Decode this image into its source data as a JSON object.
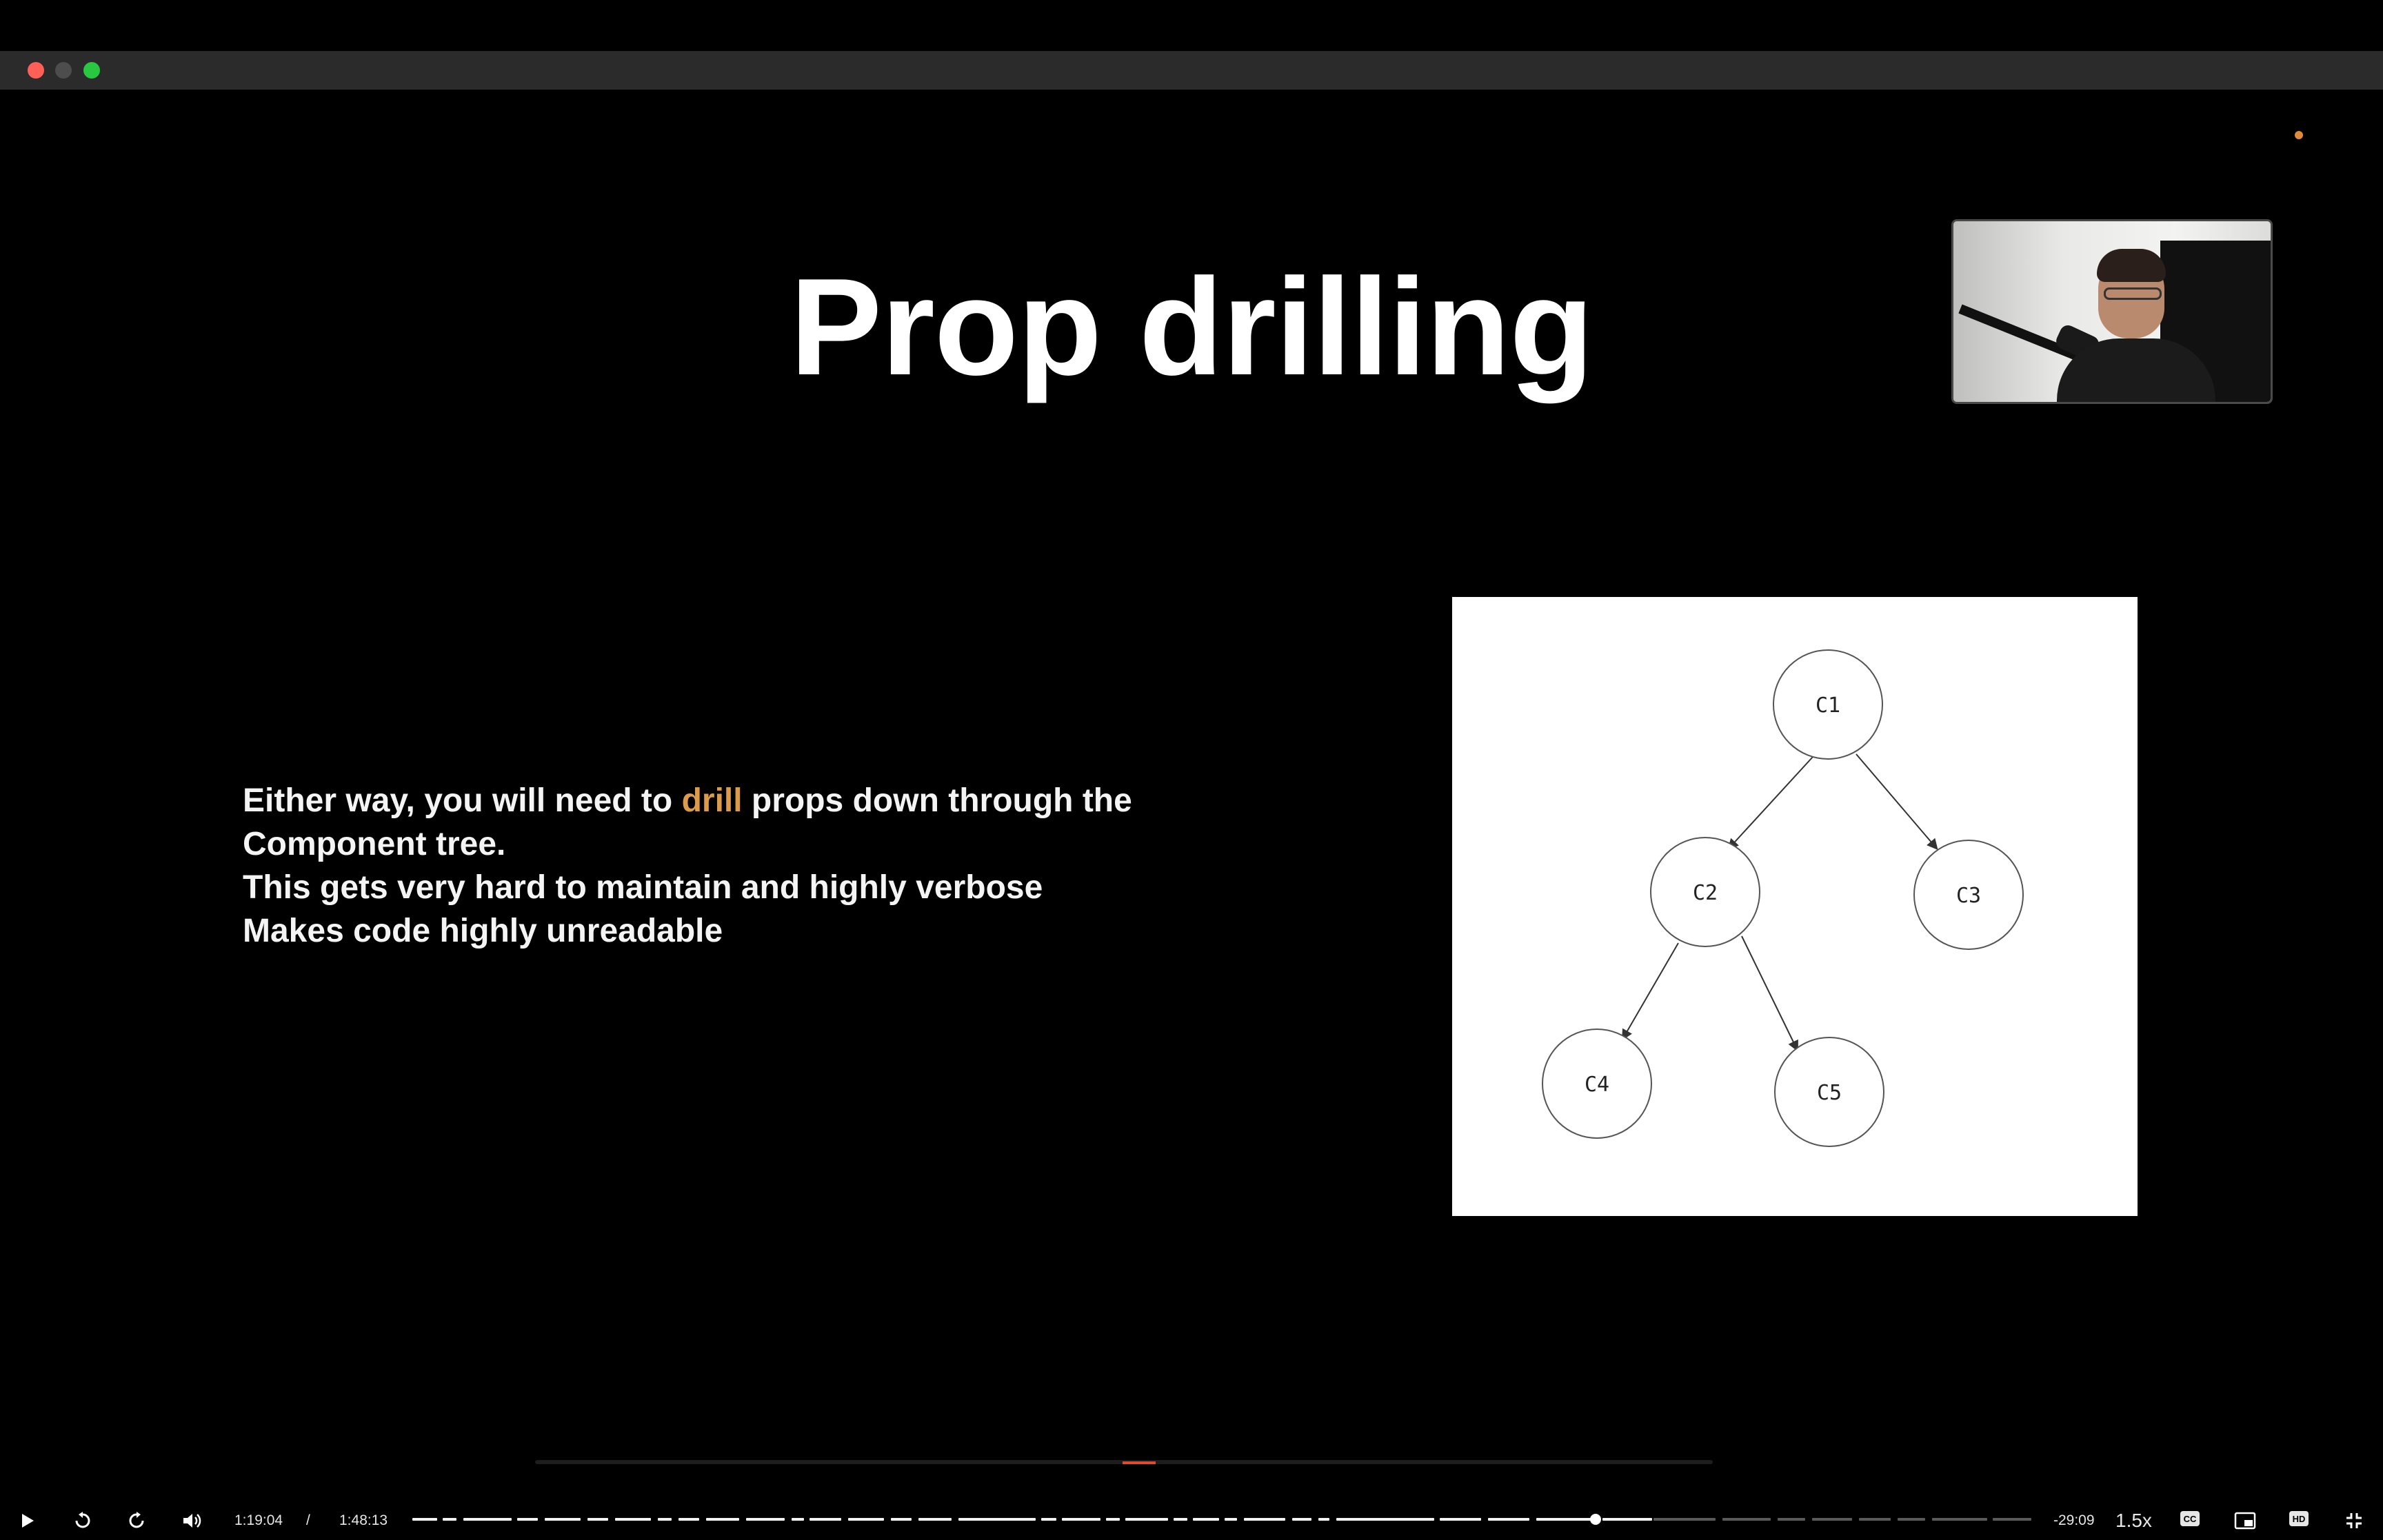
{
  "window": {
    "controls": [
      "close",
      "minimize",
      "zoom"
    ]
  },
  "slide": {
    "title": "Prop drilling",
    "bullets": {
      "line1_before": "Either way, you will need to ",
      "line1_highlight": "drill",
      "line1_after": " props down through the",
      "line2": "Component tree.",
      "line3": "This gets very hard to maintain and highly verbose",
      "line4": "Makes code highly unreadable"
    },
    "highlight_color": "#dc9b4a",
    "diagram": {
      "nodes": [
        "C1",
        "C2",
        "C3",
        "C4",
        "C5"
      ],
      "edges": [
        [
          "C1",
          "C2"
        ],
        [
          "C1",
          "C3"
        ],
        [
          "C2",
          "C4"
        ],
        [
          "C2",
          "C5"
        ]
      ]
    }
  },
  "player": {
    "current_time": "1:19:04",
    "separator": "/",
    "duration": "1:48:13",
    "remaining": "-29:09",
    "speed": "1.5x",
    "progress_fraction": 0.731,
    "icons": [
      "play-icon",
      "rewind-icon",
      "forward-icon",
      "volume-icon",
      "captions-icon",
      "pip-icon",
      "hd-icon",
      "exit-fullscreen-icon"
    ],
    "hd_label": "HD",
    "cc_label": "CC"
  }
}
